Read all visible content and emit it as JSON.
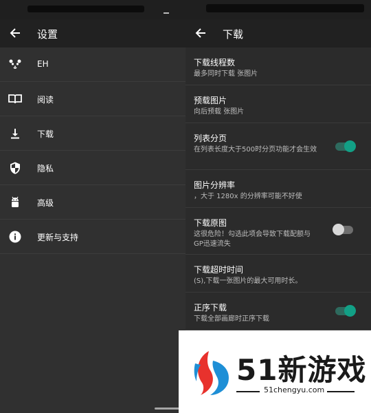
{
  "left_panel": {
    "title": "设置",
    "menu": [
      {
        "label": "EH",
        "icon": "panda-icon"
      },
      {
        "label": "阅读",
        "icon": "book-icon"
      },
      {
        "label": "下载",
        "icon": "download-icon"
      },
      {
        "label": "隐私",
        "icon": "shield-icon"
      },
      {
        "label": "高级",
        "icon": "android-icon"
      },
      {
        "label": "更新与支持",
        "icon": "info-icon"
      }
    ]
  },
  "right_panel": {
    "title": "下载",
    "settings": [
      {
        "title": "下载线程数",
        "summary": "最多同时下载  张图片"
      },
      {
        "title": "预载图片",
        "summary": "向后预载  张图片"
      },
      {
        "title": "列表分页",
        "summary": "在列表长度大于500时分页功能才会生效",
        "toggle": "on"
      },
      {
        "title": "图片分辨率",
        "summary": "，大于 1280x 的分辨率可能不好使"
      },
      {
        "title": "下载原图",
        "summary": "这很危险！勾选此项会导致下载配额与GP迅速流失",
        "toggle": "off"
      },
      {
        "title": "下载超时时间",
        "summary": "(S),下载一张图片的最大可用时长。"
      },
      {
        "title": "正序下载",
        "summary": "下载全部画廊时正序下载",
        "toggle": "on"
      }
    ]
  },
  "watermark": {
    "brand": "51新游戏",
    "url": "51chengyu.com"
  },
  "colors": {
    "accent": "#12a086",
    "toolbar": "#212121",
    "background": "#2f2f2f"
  }
}
